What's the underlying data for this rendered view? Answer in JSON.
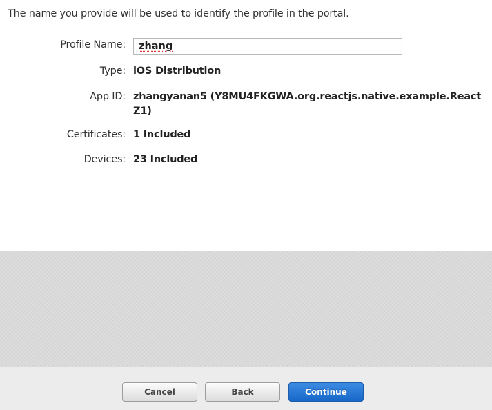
{
  "intro_text": "The name you provide will be used to identify the profile in the portal.",
  "form": {
    "profile_name_label": "Profile Name:",
    "profile_name_value": "zhang",
    "type_label": "Type:",
    "type_value": "iOS Distribution",
    "app_id_label": "App ID:",
    "app_id_value": "zhangyanan5 (Y8MU4FKGWA.org.reactjs.native.example.ReactZ1)",
    "certificates_label": "Certificates:",
    "certificates_value": "1 Included",
    "devices_label": "Devices:",
    "devices_value": "23 Included"
  },
  "buttons": {
    "cancel": "Cancel",
    "back": "Back",
    "continue": "Continue"
  },
  "colors": {
    "primary_button": "#1767c9",
    "panel_gray": "#dcdcdc",
    "footer_gray": "#ececec"
  }
}
